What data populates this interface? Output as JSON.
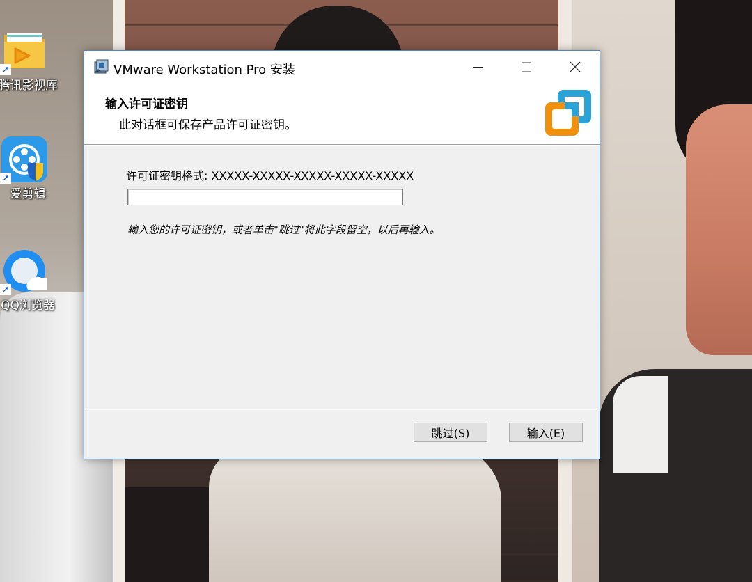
{
  "desktop": {
    "icons": [
      {
        "label": "腾讯影视库",
        "icon": "tencent-video-folder-icon"
      },
      {
        "label": "爱剪辑",
        "icon": "aijianji-film-icon"
      },
      {
        "label": "QQ浏览器",
        "icon": "qq-browser-icon"
      }
    ],
    "shortcut_arrow": "↗"
  },
  "window": {
    "title": "VMware Workstation Pro 安装",
    "controls": {
      "minimize": "minimize-icon",
      "maximize": "maximize-icon",
      "close": "close-icon"
    },
    "header": {
      "title": "输入许可证密钥",
      "subtitle": "此对话框可保存产品许可证密钥。",
      "logo": "vmware-logo"
    },
    "body": {
      "format_label": "许可证密钥格式: XXXXX-XXXXX-XXXXX-XXXXX-XXXXX",
      "key_input_value": "",
      "hint": "输入您的许可证密钥，或者单击\"跳过\"将此字段留空，以后再输入。"
    },
    "buttons": {
      "skip": "跳过(S)",
      "enter": "输入(E)"
    }
  },
  "colors": {
    "window_border": "#4f86c6",
    "logo_blue": "#2aa3d8",
    "logo_orange": "#f0900c"
  }
}
